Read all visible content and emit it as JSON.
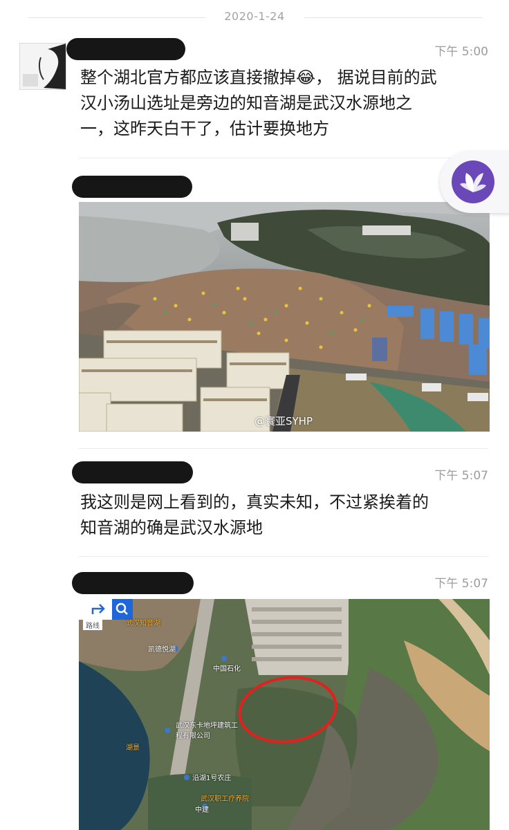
{
  "date_divider": "2020-1-24",
  "messages": [
    {
      "time": "下午 5:00",
      "lines": [
        "整个湖北官方都应该直接撤掉😂， 据说目前的武",
        "汉小汤山选址是旁边的知音湖是武汉水源地之",
        "一，这昨天白干了，估计要换地方"
      ]
    },
    {
      "time": "",
      "photo_watermark": "@寰亚SYHP"
    },
    {
      "time": "下午 5:07",
      "lines": [
        "我这则是网上看到的，真实未知，不过紧挨着的",
        "知音湖的确是武汉水源地"
      ]
    },
    {
      "time": "下午 5:07",
      "map_labels": {
        "toolbar_left": "路线",
        "top_left": "武汉知音湖",
        "a": "凯德悦湖",
        "b": "中国石化",
        "c": "武汉东卡地坪建筑工程有限公司",
        "d": "沿湖1号农庄",
        "e": "武汉职工疗养院",
        "f": "中建",
        "g": "湖景"
      }
    }
  ],
  "colors": {
    "accent_purple": "#6b48b8",
    "map_circle": "#e3201e"
  }
}
